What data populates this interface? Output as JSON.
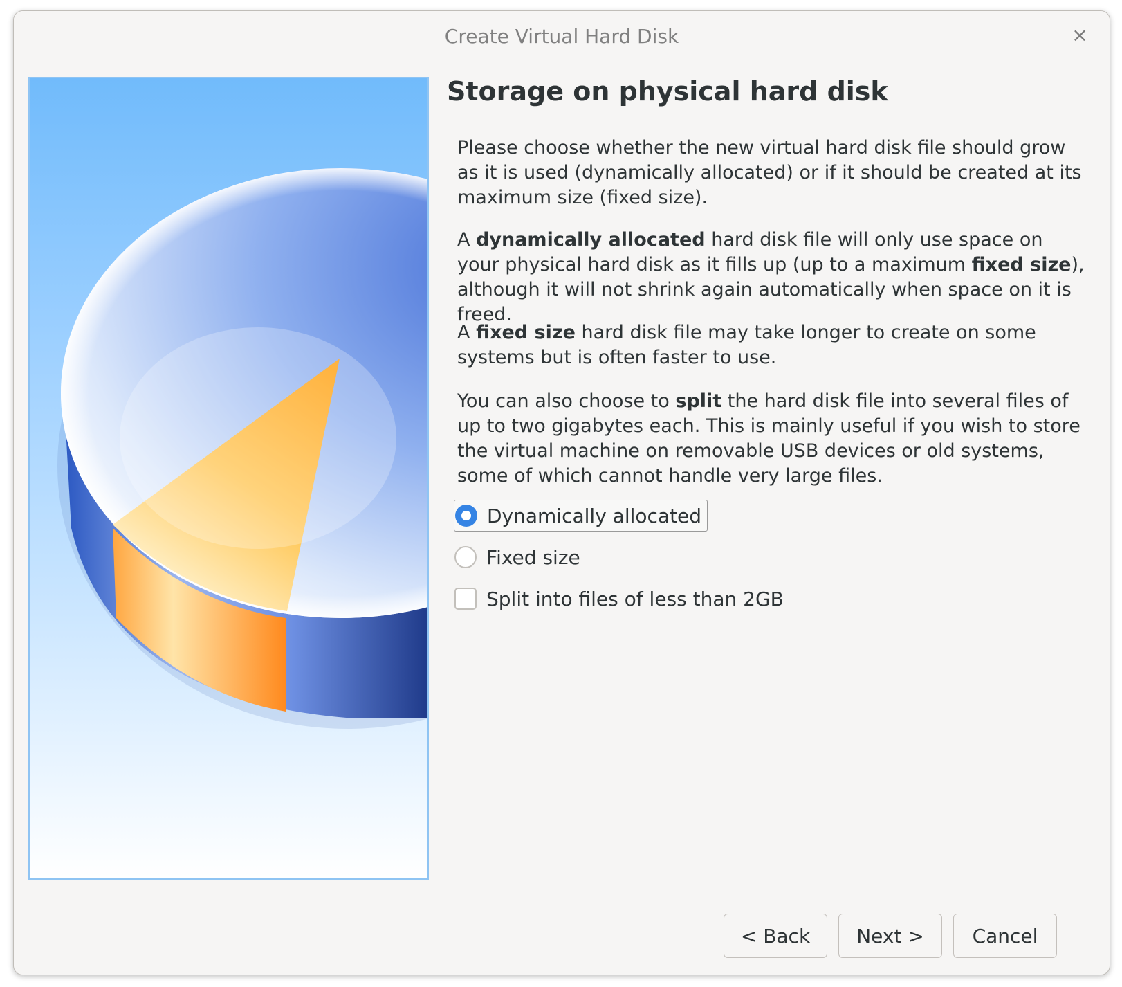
{
  "window": {
    "title": "Create Virtual Hard Disk",
    "close_glyph": "×"
  },
  "page": {
    "heading": "Storage on physical hard disk",
    "paragraphs": [
      {
        "parts": [
          {
            "text": "Please choose whether the new virtual hard disk file should grow as it is used (dynamically allocated) or if it should be created at its maximum size (fixed size).",
            "bold": false
          }
        ]
      },
      {
        "parts": [
          {
            "text": "A ",
            "bold": false
          },
          {
            "text": "dynamically allocated",
            "bold": true
          },
          {
            "text": " hard disk file will only use space on your physical hard disk as it fills up (up to a maximum ",
            "bold": false
          },
          {
            "text": "fixed size",
            "bold": true
          },
          {
            "text": "), although it will not shrink again automatically when space on it is freed.",
            "bold": false
          }
        ]
      },
      {
        "parts": [
          {
            "text": "A ",
            "bold": false
          },
          {
            "text": "fixed size",
            "bold": true
          },
          {
            "text": " hard disk file may take longer to create on some systems but is often faster to use.",
            "bold": false
          }
        ]
      },
      {
        "parts": [
          {
            "text": "You can also choose to ",
            "bold": false
          },
          {
            "text": "split",
            "bold": true
          },
          {
            "text": " the hard disk file into several files of up to two gigabytes each. This is mainly useful if you wish to store the virtual machine on removable USB devices or old systems, some of which cannot handle very large files.",
            "bold": false
          }
        ]
      }
    ],
    "options": {
      "dynamic": {
        "label": "Dynamically allocated",
        "checked": true
      },
      "fixed": {
        "label": "Fixed size",
        "checked": false
      },
      "split": {
        "label": "Split into files of less than 2GB",
        "checked": false
      }
    }
  },
  "buttons": {
    "back": "< Back",
    "next": "Next >",
    "cancel": "Cancel"
  },
  "colors": {
    "accent": "#3584e4",
    "window_bg": "#f6f5f4",
    "text": "#2e3436"
  },
  "icons": {
    "close": "close-icon",
    "illustration": "hard-disk-pie-illustration"
  }
}
